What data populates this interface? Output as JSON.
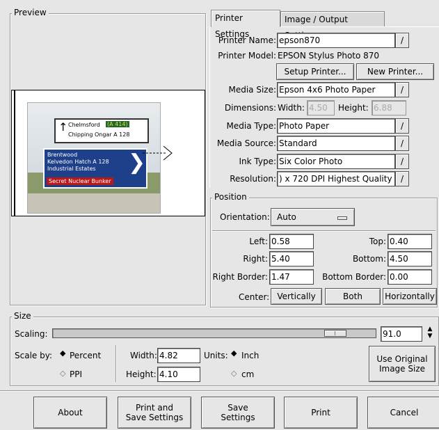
{
  "preview": {
    "title": "Preview",
    "image": {
      "sign_top_line1": "Chelmsford",
      "sign_top_badge": "(A 414)",
      "sign_top_line2": "Chipping Ongar  A 128",
      "sign_main_line1": "Brentwood",
      "sign_main_line2": "Kelvedon Hatch  A 128",
      "sign_main_line3": "Industrial Estates",
      "sign_banner": "Secret Nuclear Bunker"
    }
  },
  "tabs": [
    "Printer Settings",
    "Image / Output Settings"
  ],
  "printer": {
    "name_label": "Printer Name:",
    "name_value": "epson870",
    "model_label": "Printer Model:",
    "model_value": "EPSON Stylus Photo 870",
    "setup_button": "Setup Printer...",
    "new_button": "New Printer...",
    "media_size_label": "Media Size:",
    "media_size_value": "Epson 4x6 Photo Paper",
    "dimensions_label": "Dimensions:",
    "width_label": "Width:",
    "width_value": "4.50",
    "height_label": "Height:",
    "height_value": "6.88",
    "media_type_label": "Media Type:",
    "media_type_value": "Photo Paper",
    "media_source_label": "Media Source:",
    "media_source_value": "Standard",
    "ink_type_label": "Ink Type:",
    "ink_type_value": "Six Color Photo",
    "resolution_label": "Resolution:",
    "resolution_value": ") x 720 DPI Highest Quality"
  },
  "position": {
    "title": "Position",
    "orientation_label": "Orientation:",
    "orientation_value": "Auto",
    "left_label": "Left:",
    "left_value": "0.58",
    "top_label": "Top:",
    "top_value": "0.40",
    "right_label": "Right:",
    "right_value": "5.40",
    "bottom_label": "Bottom:",
    "bottom_value": "4.50",
    "right_border_label": "Right Border:",
    "right_border_value": "1.47",
    "bottom_border_label": "Bottom Border:",
    "bottom_border_value": "0.00",
    "center_label": "Center:",
    "vertically_button": "Vertically",
    "both_button": "Both",
    "horizontally_button": "Horizontally"
  },
  "size": {
    "title": "Size",
    "scaling_label": "Scaling:",
    "scaling_value": "91.0",
    "scale_by_label": "Scale by:",
    "percent_option": "Percent",
    "ppi_option": "PPI",
    "width_label": "Width:",
    "width_value": "4.82",
    "height_label": "Height:",
    "height_value": "4.10",
    "units_label": "Units:",
    "inch_option": "Inch",
    "cm_option": "cm",
    "original_size_button": "Use Original\nImage Size"
  },
  "actions": {
    "about": "About",
    "print_save": "Print and\nSave Settings",
    "save": "Save\nSettings",
    "print": "Print",
    "cancel": "Cancel"
  }
}
